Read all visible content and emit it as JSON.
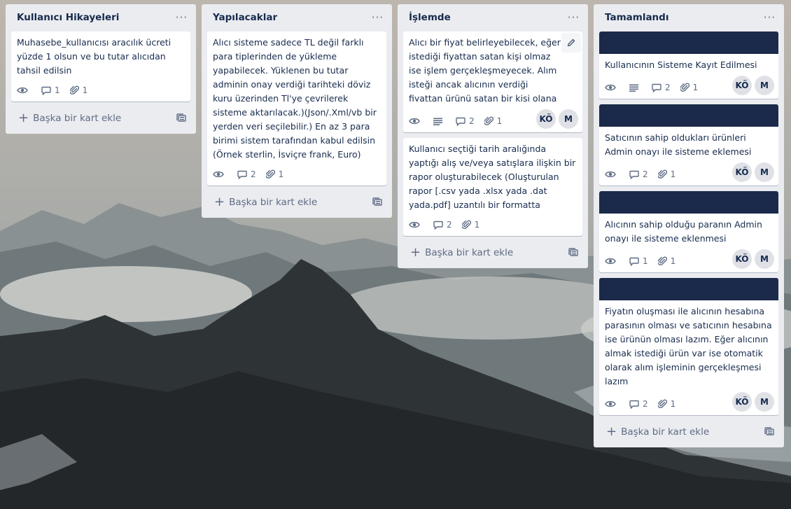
{
  "lists": [
    {
      "title": "Kullanıcı Hikayeleri",
      "add_label": "Başka bir kart ekle",
      "cards": [
        {
          "text": "Muhasebe_kullanıcısı aracılık ücreti yüzde 1 olsun ve bu tutar alıcıdan tahsil edilsin",
          "comments": "1",
          "attachments": "1"
        }
      ]
    },
    {
      "title": "Yapılacaklar",
      "add_label": "Başka bir kart ekle",
      "cards": [
        {
          "text": "Alıcı sisteme sadece TL değil farklı para tiplerinden de yükleme yapabilecek. Yüklenen bu tutar adminin onay verdiği tarihteki döviz kuru üzerinden Tl'ye çevrilerek sisteme aktarılacak.)(Json/.Xml/vb bir yerden veri seçilebilir.) En az 3 para birimi sistem tarafından kabul edilsin (Örnek sterlin, İsviçre frank, Euro)",
          "comments": "2",
          "attachments": "1"
        }
      ]
    },
    {
      "title": "İşlemde",
      "add_label": "Başka bir kart ekle",
      "cards": [
        {
          "text": "Alıcı bir fiyat belirleyebilecek, eğer istediği fiyattan satan kişi olmaz ise işlem gerçekleşmeyecek. Alım isteği ancak alıcının verdiği fiyattan ürünü satan bir kişi olana kadar bekleyecek",
          "comments": "2",
          "attachments": "1",
          "members": [
            "KÖ",
            "M"
          ]
        },
        {
          "text": "Kullanıcı seçtiği tarih aralığında yaptığı alış ve/veya satışlara ilişkin bir rapor oluşturabilecek (Oluşturulan rapor [.csv yada .xlsx yada .dat yada.pdf] uzantılı bir formatta dönüştürülecek",
          "comments": "2",
          "attachments": "1"
        }
      ]
    },
    {
      "title": "Tamamlandı",
      "add_label": "Başka bir kart ekle",
      "cards": [
        {
          "text": "Kullanıcının Sisteme Kayıt Edilmesi",
          "comments": "2",
          "attachments": "1",
          "members": [
            "KÖ",
            "M"
          ]
        },
        {
          "text": "Satıcının sahip oldukları ürünleri Admin onayı ile sisteme eklemesi",
          "comments": "2",
          "attachments": "1",
          "members": [
            "KÖ",
            "M"
          ]
        },
        {
          "text": "Alıcının sahip olduğu paranın Admin onayı ile sisteme eklenmesi",
          "comments": "1",
          "attachments": "1",
          "members": [
            "KÖ",
            "M"
          ]
        },
        {
          "text": "Fiyatın oluşması ile alıcının hesabına parasının olması ve satıcının hesabına ise ürünün olması lazım. Eğer alıcının almak istediği ürün var ise otomatik olarak alım işleminin gerçekleşmesi lazım",
          "comments": "2",
          "attachments": "1",
          "members": [
            "KÖ",
            "M"
          ]
        }
      ]
    }
  ],
  "colors": {
    "list_bg": "#ebecf0",
    "card_cover": "#1b2a4a",
    "text": "#172b4d",
    "muted": "#5e6c84"
  }
}
